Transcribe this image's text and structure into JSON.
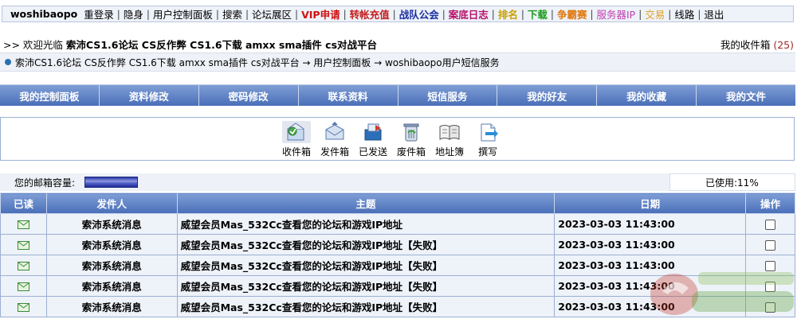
{
  "topnav": {
    "items": [
      {
        "label": "woshibaopo",
        "color": "#000000",
        "bold": true
      },
      {
        "label": "重登录",
        "color": "#000000",
        "bold": false
      },
      {
        "label": "隐身",
        "color": "#000000",
        "bold": false
      },
      {
        "label": "用户控制面板",
        "color": "#000000",
        "bold": false
      },
      {
        "label": "搜索",
        "color": "#000000",
        "bold": false
      },
      {
        "label": "论坛展区",
        "color": "#000000",
        "bold": false
      },
      {
        "label": "VIP申请",
        "color": "#d01010",
        "bold": true
      },
      {
        "label": "转帐充值",
        "color": "#c41e1e",
        "bold": true
      },
      {
        "label": "战队公会",
        "color": "#1b2fa0",
        "bold": true
      },
      {
        "label": "案底日志",
        "color": "#b8106a",
        "bold": true
      },
      {
        "label": "排名",
        "color": "#c8a000",
        "bold": true
      },
      {
        "label": "下载",
        "color": "#1a9a1a",
        "bold": true
      },
      {
        "label": "争霸赛",
        "color": "#e07a10",
        "bold": true
      },
      {
        "label": "服务器IP",
        "color": "#c040b0",
        "bold": false
      },
      {
        "label": "交易",
        "color": "#e0a020",
        "bold": false
      },
      {
        "label": "线路",
        "color": "#000000",
        "bold": false
      },
      {
        "label": "退出",
        "color": "#000000",
        "bold": false
      }
    ]
  },
  "welcome": {
    "prefix": ">> 欢迎光临",
    "site": "索沛CS1.6论坛 CS反作弊 CS1.6下载 amxx sma插件 cs对战平台",
    "inbox_label": "我的收件箱",
    "inbox_count": "(25)"
  },
  "breadcrumb": {
    "text": "索沛CS1.6论坛 CS反作弊 CS1.6下载 amxx sma插件 cs对战平台 → 用户控制面板 → woshibaopo用户短信服务"
  },
  "menubar": {
    "items": [
      "我的控制面板",
      "资料修改",
      "密码修改",
      "联系资料",
      "短信服务",
      "我的好友",
      "我的收藏",
      "我的文件"
    ]
  },
  "tools": [
    {
      "label": "收件箱",
      "icon": "inbox-icon"
    },
    {
      "label": "发件箱",
      "icon": "outbox-icon"
    },
    {
      "label": "已发送",
      "icon": "sent-icon"
    },
    {
      "label": "废件箱",
      "icon": "trash-icon"
    },
    {
      "label": "地址簿",
      "icon": "address-book-icon"
    },
    {
      "label": "撰写",
      "icon": "compose-icon"
    }
  ],
  "capacity": {
    "label": "您的邮箱容量:",
    "used_label": "已使用:11%",
    "used_fraction": 0.11
  },
  "table": {
    "headers": {
      "read": "已读",
      "sender": "发件人",
      "subject": "主题",
      "date": "日期",
      "op": "操作"
    },
    "rows": [
      {
        "sender": "索沛系统消息",
        "subject": "威望会员Mas_532Cc查看您的论坛和游戏IP地址",
        "date": "2023-03-03 11:43:00"
      },
      {
        "sender": "索沛系统消息",
        "subject": "威望会员Mas_532Cc查看您的论坛和游戏IP地址【失败】",
        "date": "2023-03-03 11:43:00"
      },
      {
        "sender": "索沛系统消息",
        "subject": "威望会员Mas_532Cc查看您的论坛和游戏IP地址【失败】",
        "date": "2023-03-03 11:43:00"
      },
      {
        "sender": "索沛系统消息",
        "subject": "威望会员Mas_532Cc查看您的论坛和游戏IP地址【失败】",
        "date": "2023-03-03 11:43:00"
      },
      {
        "sender": "索沛系统消息",
        "subject": "威望会员Mas_532Cc查看您的论坛和游戏IP地址【失败】",
        "date": "2023-03-03 11:43:00"
      }
    ]
  },
  "colors": {
    "menu_blue": "#4a6fb8",
    "cell_bg": "#eef2f9",
    "inbox_count": "#a0282a"
  }
}
